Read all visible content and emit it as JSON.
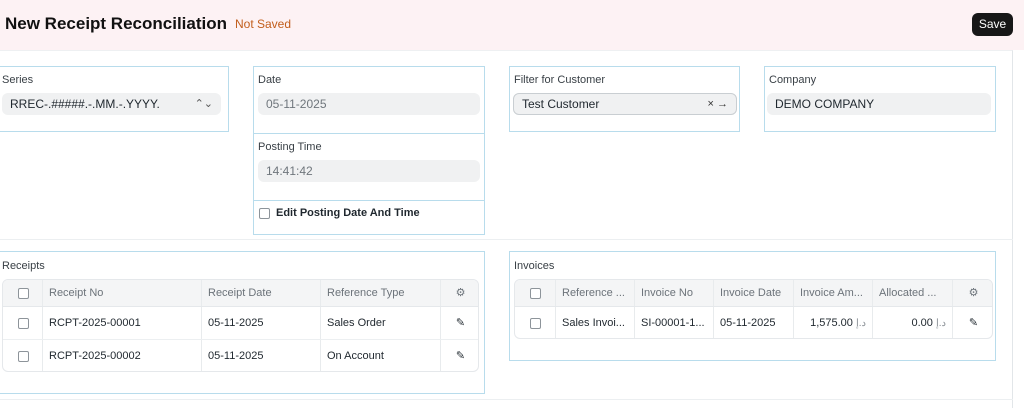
{
  "header": {
    "title": "New Receipt Reconciliation",
    "status": "Not Saved",
    "save_label": "Save"
  },
  "fields": {
    "series": {
      "label": "Series",
      "value": "RREC-.#####.-.MM.-.YYYY."
    },
    "date": {
      "label": "Date",
      "value": "05-11-2025"
    },
    "posting_time": {
      "label": "Posting Time",
      "value": "14:41:42"
    },
    "edit_posting": {
      "label": "Edit Posting Date And Time"
    },
    "customer": {
      "label": "Filter for Customer",
      "value": "Test Customer"
    },
    "company": {
      "label": "Company",
      "value": "DEMO COMPANY"
    }
  },
  "receipts": {
    "label": "Receipts",
    "columns": [
      "Receipt No",
      "Receipt Date",
      "Reference Type"
    ],
    "rows": [
      {
        "no": "RCPT-2025-00001",
        "date": "05-11-2025",
        "type": "Sales Order"
      },
      {
        "no": "RCPT-2025-00002",
        "date": "05-11-2025",
        "type": "On Account"
      }
    ]
  },
  "invoices": {
    "label": "Invoices",
    "columns": [
      "Reference ...",
      "Invoice No",
      "Invoice Date",
      "Invoice Am...",
      "Allocated ..."
    ],
    "rows": [
      {
        "ref": "Sales Invoi...",
        "no": "SI-00001-1...",
        "date": "05-11-2025",
        "amount": "1,575.00",
        "allocated": "0.00",
        "currency": "د.إ"
      }
    ]
  },
  "icons": {
    "select": "select-arrows-icon",
    "clear": "clear-icon",
    "arrow": "arrow-right-icon",
    "gear": "gear-icon",
    "edit": "edit-icon"
  }
}
